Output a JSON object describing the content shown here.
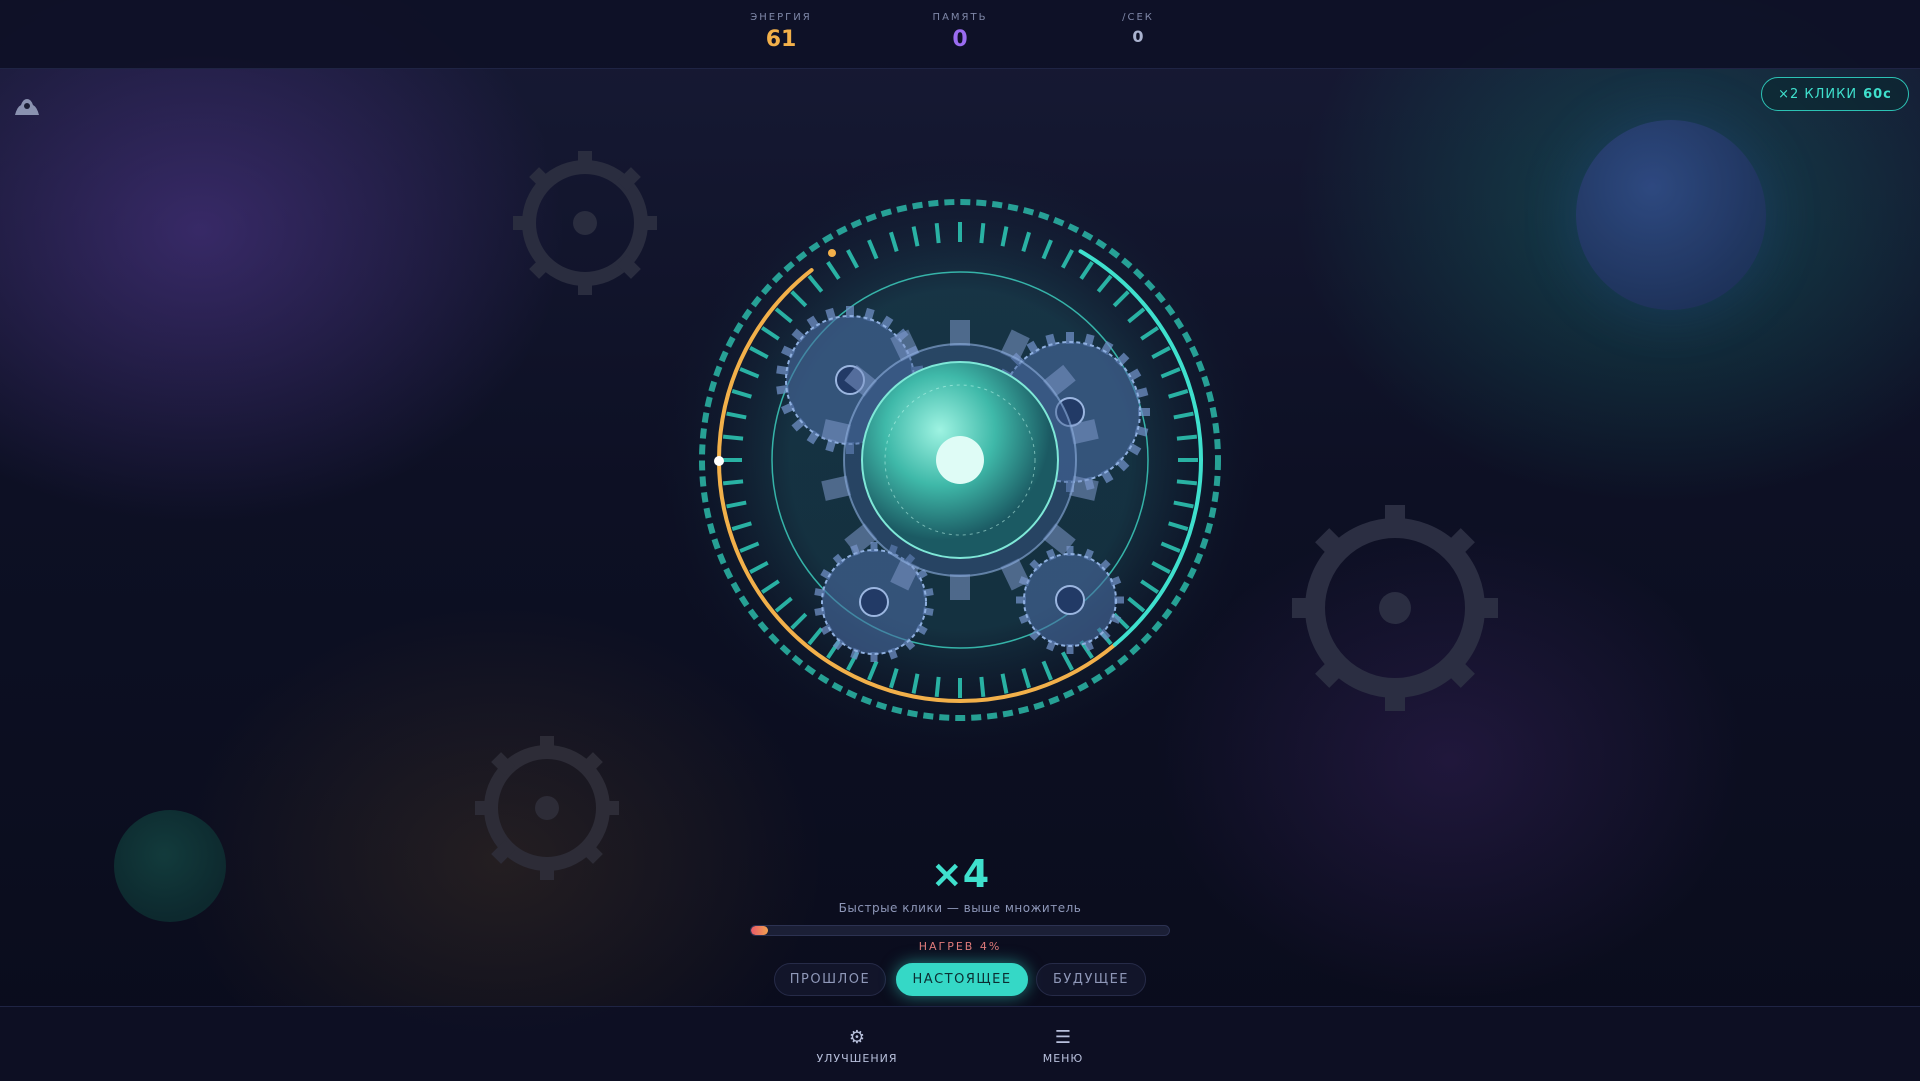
{
  "stats": {
    "energy": {
      "label": "ЭНЕРГИЯ",
      "value": "61",
      "color": "#f2b04a"
    },
    "memory": {
      "label": "ПАМЯТЬ",
      "value": "0",
      "color": "#9a6cf0"
    },
    "rate": {
      "label": "/СЕК",
      "value": "0"
    }
  },
  "boost": {
    "prefix": "×2 КЛИКИ",
    "timer": "60с",
    "color": "#3fe0cd"
  },
  "ghost_icon": "ghost-icon",
  "dial": {
    "accent": "#3fe0cd",
    "progress_color": "#f2b04a",
    "progress_fraction": 0.42
  },
  "multiplier": {
    "value": "×4",
    "hint": "Быстрые клики — выше множитель"
  },
  "heat": {
    "label": "НАГРЕВ 4%",
    "percent": 4
  },
  "time_tabs": [
    {
      "label": "ПРОШЛОЕ",
      "active": false
    },
    {
      "label": "НАСТОЯЩЕЕ",
      "active": true
    },
    {
      "label": "БУДУЩЕЕ",
      "active": false
    }
  ],
  "nav": {
    "upgrades": {
      "icon": "gear-icon",
      "glyph": "⚙",
      "label": "УЛУЧШЕНИЯ"
    },
    "menu": {
      "icon": "menu-icon",
      "glyph": "☰",
      "label": "МЕНЮ"
    }
  }
}
